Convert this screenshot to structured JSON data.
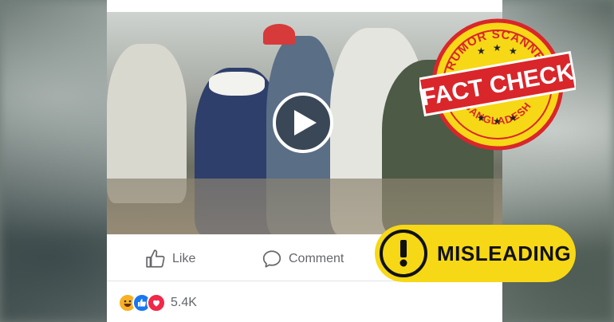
{
  "post": {
    "actions": [
      {
        "label": "Like",
        "icon": "thumbs-up-icon"
      },
      {
        "label": "Comment",
        "icon": "comment-icon"
      }
    ],
    "reactions": {
      "icons": [
        "haha-icon",
        "like-reaction-icon",
        "love-icon"
      ],
      "count": "5.4K"
    }
  },
  "stamp": {
    "top_text": "RUMOR SCANNER",
    "main_text": "FACT CHECK",
    "bottom_text": "BANGLADESH"
  },
  "verdict": {
    "label": "MISLEADING",
    "icon": "exclamation-icon",
    "color": "#f6d816"
  },
  "colors": {
    "stamp_red": "#d9262b",
    "stamp_yellow": "#f6d816",
    "action_gray": "#65676b"
  }
}
